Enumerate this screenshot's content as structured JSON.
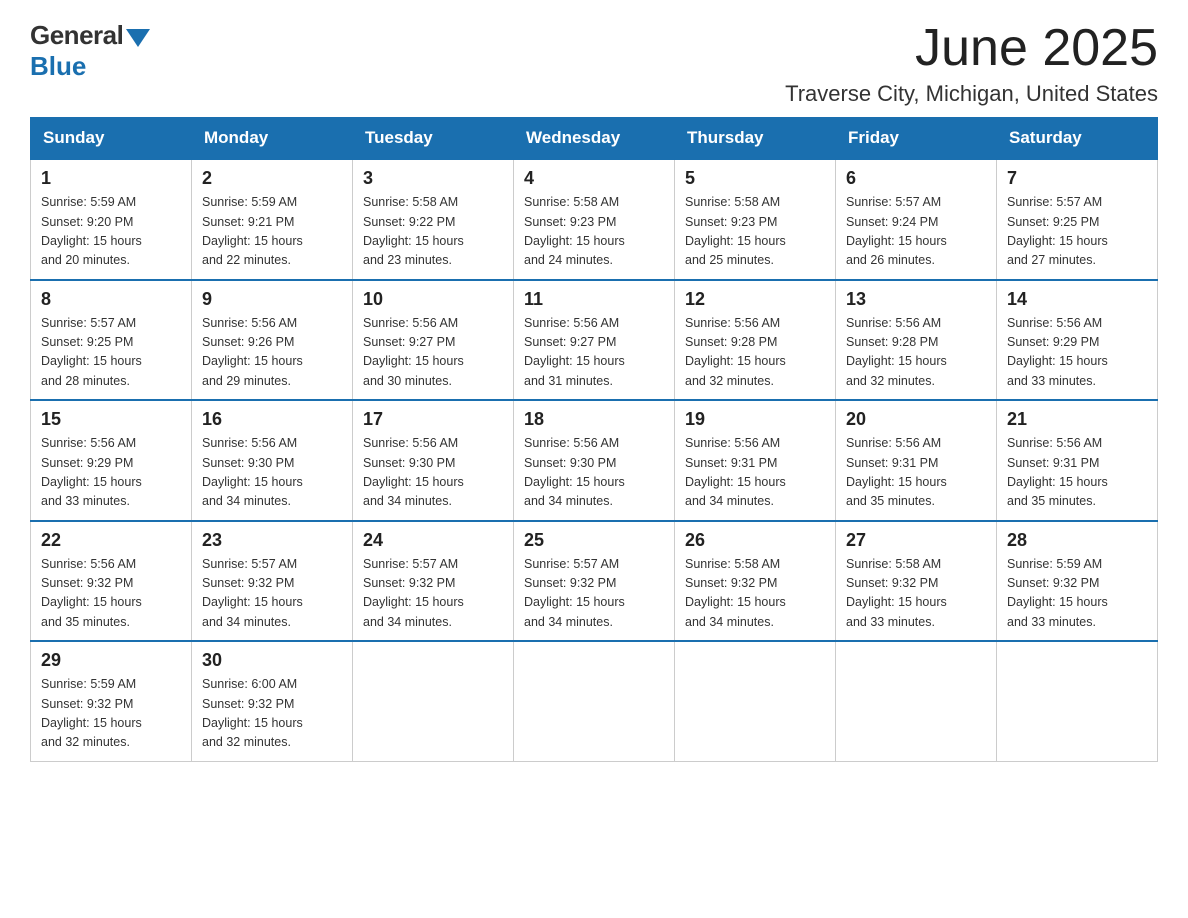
{
  "logo": {
    "general": "General",
    "blue": "Blue"
  },
  "title": "June 2025",
  "subtitle": "Traverse City, Michigan, United States",
  "days_of_week": [
    "Sunday",
    "Monday",
    "Tuesday",
    "Wednesday",
    "Thursday",
    "Friday",
    "Saturday"
  ],
  "weeks": [
    [
      {
        "day": "1",
        "sunrise": "Sunrise: 5:59 AM",
        "sunset": "Sunset: 9:20 PM",
        "daylight": "Daylight: 15 hours and 20 minutes."
      },
      {
        "day": "2",
        "sunrise": "Sunrise: 5:59 AM",
        "sunset": "Sunset: 9:21 PM",
        "daylight": "Daylight: 15 hours and 22 minutes."
      },
      {
        "day": "3",
        "sunrise": "Sunrise: 5:58 AM",
        "sunset": "Sunset: 9:22 PM",
        "daylight": "Daylight: 15 hours and 23 minutes."
      },
      {
        "day": "4",
        "sunrise": "Sunrise: 5:58 AM",
        "sunset": "Sunset: 9:23 PM",
        "daylight": "Daylight: 15 hours and 24 minutes."
      },
      {
        "day": "5",
        "sunrise": "Sunrise: 5:58 AM",
        "sunset": "Sunset: 9:23 PM",
        "daylight": "Daylight: 15 hours and 25 minutes."
      },
      {
        "day": "6",
        "sunrise": "Sunrise: 5:57 AM",
        "sunset": "Sunset: 9:24 PM",
        "daylight": "Daylight: 15 hours and 26 minutes."
      },
      {
        "day": "7",
        "sunrise": "Sunrise: 5:57 AM",
        "sunset": "Sunset: 9:25 PM",
        "daylight": "Daylight: 15 hours and 27 minutes."
      }
    ],
    [
      {
        "day": "8",
        "sunrise": "Sunrise: 5:57 AM",
        "sunset": "Sunset: 9:25 PM",
        "daylight": "Daylight: 15 hours and 28 minutes."
      },
      {
        "day": "9",
        "sunrise": "Sunrise: 5:56 AM",
        "sunset": "Sunset: 9:26 PM",
        "daylight": "Daylight: 15 hours and 29 minutes."
      },
      {
        "day": "10",
        "sunrise": "Sunrise: 5:56 AM",
        "sunset": "Sunset: 9:27 PM",
        "daylight": "Daylight: 15 hours and 30 minutes."
      },
      {
        "day": "11",
        "sunrise": "Sunrise: 5:56 AM",
        "sunset": "Sunset: 9:27 PM",
        "daylight": "Daylight: 15 hours and 31 minutes."
      },
      {
        "day": "12",
        "sunrise": "Sunrise: 5:56 AM",
        "sunset": "Sunset: 9:28 PM",
        "daylight": "Daylight: 15 hours and 32 minutes."
      },
      {
        "day": "13",
        "sunrise": "Sunrise: 5:56 AM",
        "sunset": "Sunset: 9:28 PM",
        "daylight": "Daylight: 15 hours and 32 minutes."
      },
      {
        "day": "14",
        "sunrise": "Sunrise: 5:56 AM",
        "sunset": "Sunset: 9:29 PM",
        "daylight": "Daylight: 15 hours and 33 minutes."
      }
    ],
    [
      {
        "day": "15",
        "sunrise": "Sunrise: 5:56 AM",
        "sunset": "Sunset: 9:29 PM",
        "daylight": "Daylight: 15 hours and 33 minutes."
      },
      {
        "day": "16",
        "sunrise": "Sunrise: 5:56 AM",
        "sunset": "Sunset: 9:30 PM",
        "daylight": "Daylight: 15 hours and 34 minutes."
      },
      {
        "day": "17",
        "sunrise": "Sunrise: 5:56 AM",
        "sunset": "Sunset: 9:30 PM",
        "daylight": "Daylight: 15 hours and 34 minutes."
      },
      {
        "day": "18",
        "sunrise": "Sunrise: 5:56 AM",
        "sunset": "Sunset: 9:30 PM",
        "daylight": "Daylight: 15 hours and 34 minutes."
      },
      {
        "day": "19",
        "sunrise": "Sunrise: 5:56 AM",
        "sunset": "Sunset: 9:31 PM",
        "daylight": "Daylight: 15 hours and 34 minutes."
      },
      {
        "day": "20",
        "sunrise": "Sunrise: 5:56 AM",
        "sunset": "Sunset: 9:31 PM",
        "daylight": "Daylight: 15 hours and 35 minutes."
      },
      {
        "day": "21",
        "sunrise": "Sunrise: 5:56 AM",
        "sunset": "Sunset: 9:31 PM",
        "daylight": "Daylight: 15 hours and 35 minutes."
      }
    ],
    [
      {
        "day": "22",
        "sunrise": "Sunrise: 5:56 AM",
        "sunset": "Sunset: 9:32 PM",
        "daylight": "Daylight: 15 hours and 35 minutes."
      },
      {
        "day": "23",
        "sunrise": "Sunrise: 5:57 AM",
        "sunset": "Sunset: 9:32 PM",
        "daylight": "Daylight: 15 hours and 34 minutes."
      },
      {
        "day": "24",
        "sunrise": "Sunrise: 5:57 AM",
        "sunset": "Sunset: 9:32 PM",
        "daylight": "Daylight: 15 hours and 34 minutes."
      },
      {
        "day": "25",
        "sunrise": "Sunrise: 5:57 AM",
        "sunset": "Sunset: 9:32 PM",
        "daylight": "Daylight: 15 hours and 34 minutes."
      },
      {
        "day": "26",
        "sunrise": "Sunrise: 5:58 AM",
        "sunset": "Sunset: 9:32 PM",
        "daylight": "Daylight: 15 hours and 34 minutes."
      },
      {
        "day": "27",
        "sunrise": "Sunrise: 5:58 AM",
        "sunset": "Sunset: 9:32 PM",
        "daylight": "Daylight: 15 hours and 33 minutes."
      },
      {
        "day": "28",
        "sunrise": "Sunrise: 5:59 AM",
        "sunset": "Sunset: 9:32 PM",
        "daylight": "Daylight: 15 hours and 33 minutes."
      }
    ],
    [
      {
        "day": "29",
        "sunrise": "Sunrise: 5:59 AM",
        "sunset": "Sunset: 9:32 PM",
        "daylight": "Daylight: 15 hours and 32 minutes."
      },
      {
        "day": "30",
        "sunrise": "Sunrise: 6:00 AM",
        "sunset": "Sunset: 9:32 PM",
        "daylight": "Daylight: 15 hours and 32 minutes."
      },
      null,
      null,
      null,
      null,
      null
    ]
  ]
}
